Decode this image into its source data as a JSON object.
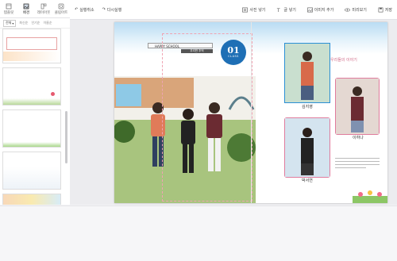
{
  "sidebar": {
    "tabs": [
      {
        "label": "템플릿",
        "icon": "template-icon"
      },
      {
        "label": "배경",
        "icon": "background-icon"
      },
      {
        "label": "레이아웃",
        "icon": "layout-icon"
      },
      {
        "label": "클립아트",
        "icon": "clipart-icon"
      }
    ],
    "filter_select": "전체",
    "filter_options": [
      "최신순",
      "인기순",
      "이름순"
    ]
  },
  "toolbar": {
    "undo_label": "실행취소",
    "redo_label": "다시실행",
    "right_items": [
      "사진 넣기",
      "글 넣기",
      "이미지 추가",
      "미리보기",
      "저장"
    ]
  },
  "page": {
    "header_left": "HAPPY SCHOOL",
    "header_sub": "우리반 추억",
    "badge_num": "01",
    "badge_label": "CLASS",
    "captions": [
      "김지영",
      "박서연",
      "이하나"
    ],
    "right_title": "우리들의 이야기"
  },
  "colors": {
    "accent": "#1e6fb5",
    "frame_blue": "#2a8fd5",
    "frame_pink": "#e07c9d"
  }
}
